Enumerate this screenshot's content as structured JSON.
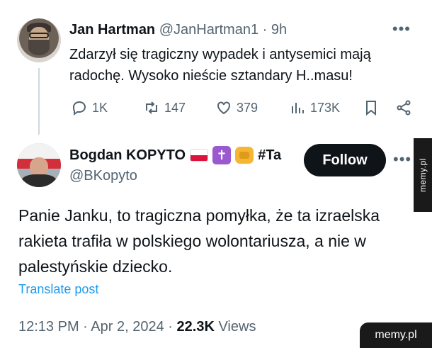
{
  "first_tweet": {
    "name": "Jan Hartman",
    "handle": "@JanHartman1",
    "separator": "·",
    "time": "9h",
    "more": "•••",
    "text": "Zdarzył się tragiczny wypadek i antysemici mają radochę. Wysoko nieście sztandary H..masu!",
    "actions": {
      "replies": "1K",
      "reposts": "147",
      "likes": "379",
      "views": "173K"
    }
  },
  "second_tweet": {
    "name": "Bogdan KOPYTO",
    "name_suffix": "#Ta",
    "cross": "✝",
    "handle": "@BKopyto",
    "follow_label": "Follow",
    "more": "•••",
    "text": "Panie Janku, to tragiczna pomyłka, że ta izraelska rakieta trafiła w polskiego wolontariusza, a nie w palestyńskie dziecko.",
    "translate_label": "Translate post",
    "time": "12:13 PM",
    "date": "Apr 2, 2024",
    "views_count": "22.3K",
    "views_label": "Views",
    "separator": "·"
  },
  "watermarks": {
    "side": "memy.pl",
    "corner": "memy.pl"
  },
  "colors": {
    "text": "#0f1419",
    "muted": "#536471",
    "link": "#1d9bf0",
    "follow_bg": "#0f1419"
  }
}
